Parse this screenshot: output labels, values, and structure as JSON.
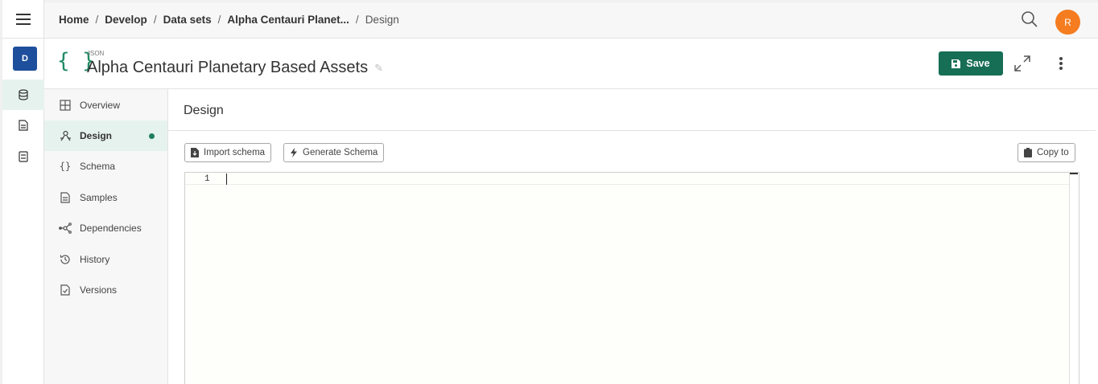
{
  "rail": {
    "workspace_initial": "D",
    "items": [
      {
        "icon": "database-icon",
        "active": true
      },
      {
        "icon": "document-icon",
        "active": false
      },
      {
        "icon": "list-icon",
        "active": false
      }
    ]
  },
  "breadcrumb": {
    "items": [
      "Home",
      "Develop",
      "Data sets",
      "Alpha Centauri Planet..."
    ],
    "current": "Design"
  },
  "user": {
    "initial": "R",
    "color": "#f57c1f"
  },
  "header": {
    "type_tag": "JSON",
    "title": "Alpha Centauri Planetary Based Assets",
    "save_label": "Save"
  },
  "nav": {
    "items": [
      {
        "label": "Overview",
        "icon": "grid-icon"
      },
      {
        "label": "Design",
        "icon": "design-icon",
        "active": true
      },
      {
        "label": "Schema",
        "icon": "braces-icon"
      },
      {
        "label": "Samples",
        "icon": "file-icon"
      },
      {
        "label": "Dependencies",
        "icon": "graph-icon"
      },
      {
        "label": "History",
        "icon": "history-icon"
      },
      {
        "label": "Versions",
        "icon": "versions-icon"
      }
    ]
  },
  "content": {
    "title": "Design",
    "import_label": "Import schema",
    "generate_label": "Generate Schema",
    "copy_label": "Copy to",
    "line_number": "1"
  },
  "colors": {
    "accent": "#166e55",
    "workspace": "#1e4f9c",
    "active_bg": "#e6f2ee"
  }
}
